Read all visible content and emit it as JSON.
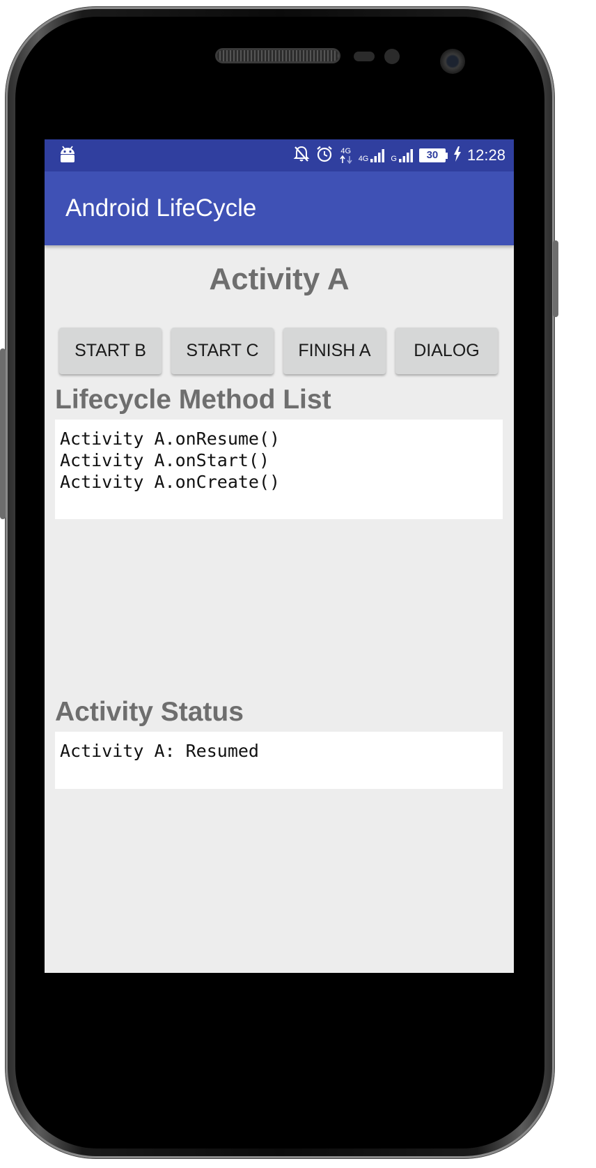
{
  "status_bar": {
    "time": "12:28",
    "battery": "30",
    "network_1": "4G",
    "network_2": "G"
  },
  "app_bar": {
    "title": "Android LifeCycle"
  },
  "main": {
    "activity_title": "Activity A",
    "buttons": [
      {
        "label": "START B"
      },
      {
        "label": "START C"
      },
      {
        "label": "FINISH A"
      },
      {
        "label": "DIALOG"
      }
    ],
    "lifecycle_title": "Lifecycle Method List",
    "lifecycle_items": [
      "Activity A.onResume()",
      "Activity A.onStart()",
      "Activity A.onCreate()"
    ],
    "status_title": "Activity Status",
    "status_items": [
      "Activity A: Resumed"
    ]
  }
}
